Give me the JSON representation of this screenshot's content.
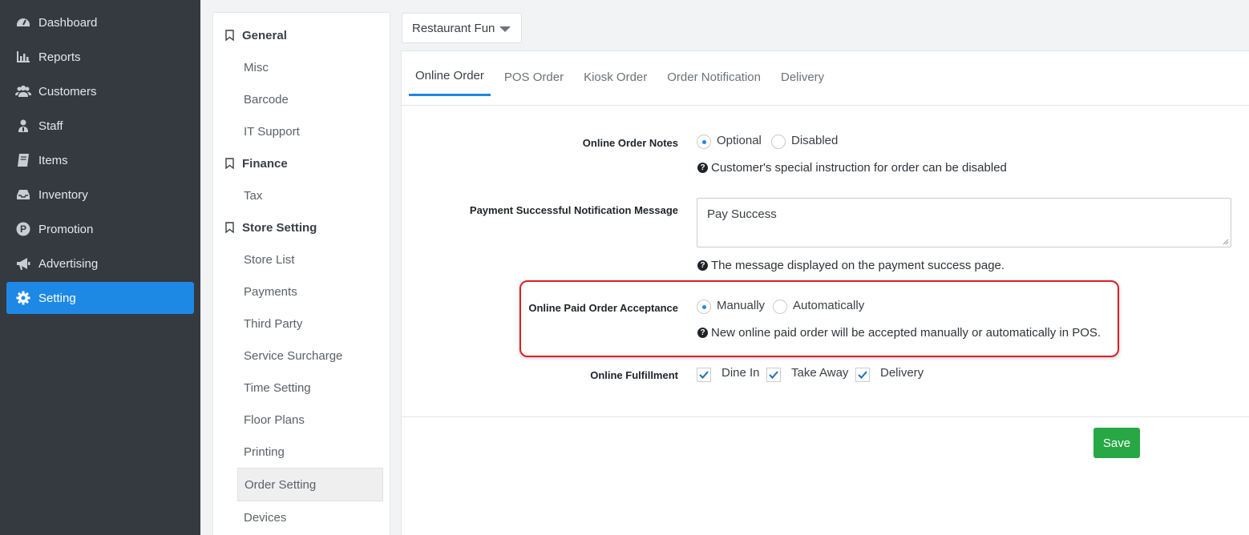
{
  "sidebar": {
    "items": [
      {
        "label": "Dashboard",
        "icon": "dashboard-icon"
      },
      {
        "label": "Reports",
        "icon": "bar-chart-icon"
      },
      {
        "label": "Customers",
        "icon": "users-icon"
      },
      {
        "label": "Staff",
        "icon": "staff-icon"
      },
      {
        "label": "Items",
        "icon": "book-icon"
      },
      {
        "label": "Inventory",
        "icon": "inbox-icon"
      },
      {
        "label": "Promotion",
        "icon": "promotion-icon"
      },
      {
        "label": "Advertising",
        "icon": "megaphone-icon"
      },
      {
        "label": "Setting",
        "icon": "gear-icon",
        "active": true
      }
    ]
  },
  "settings_menu": {
    "general": {
      "title": "General",
      "items": [
        "Misc",
        "Barcode",
        "IT Support"
      ]
    },
    "finance": {
      "title": "Finance",
      "items": [
        "Tax"
      ]
    },
    "store_setting": {
      "title": "Store Setting",
      "items": [
        "Store List",
        "Payments",
        "Third Party",
        "Service Surcharge",
        "Time Setting",
        "Floor Plans",
        "Printing",
        "Order Setting",
        "Devices"
      ],
      "active": "Order Setting"
    }
  },
  "store_select": {
    "value": "Restaurant Fun"
  },
  "tabs": [
    "Online Order",
    "POS Order",
    "Kiosk Order",
    "Order Notification",
    "Delivery"
  ],
  "active_tab": "Online Order",
  "form": {
    "notes": {
      "label": "Online Order Notes",
      "options": [
        "Optional",
        "Disabled"
      ],
      "selected": "Optional",
      "help": "Customer's special instruction for order can be disabled"
    },
    "payment_message": {
      "label": "Payment Successful Notification Message",
      "value": "Pay Success",
      "help": "The message displayed on the payment success page."
    },
    "acceptance": {
      "label": "Online Paid Order Acceptance",
      "options": [
        "Manually",
        "Automatically"
      ],
      "selected": "Manually",
      "help": "New online paid order will be accepted manually or automatically in POS."
    },
    "fulfillment": {
      "label": "Online Fulfillment",
      "options": [
        "Dine In",
        "Take Away",
        "Delivery"
      ],
      "checked": [
        true,
        true,
        true
      ]
    }
  },
  "save_label": "Save",
  "colors": {
    "sidebar_bg": "#343a40",
    "accent": "#1e88e5",
    "save": "#28a745",
    "highlight": "#d92027"
  }
}
